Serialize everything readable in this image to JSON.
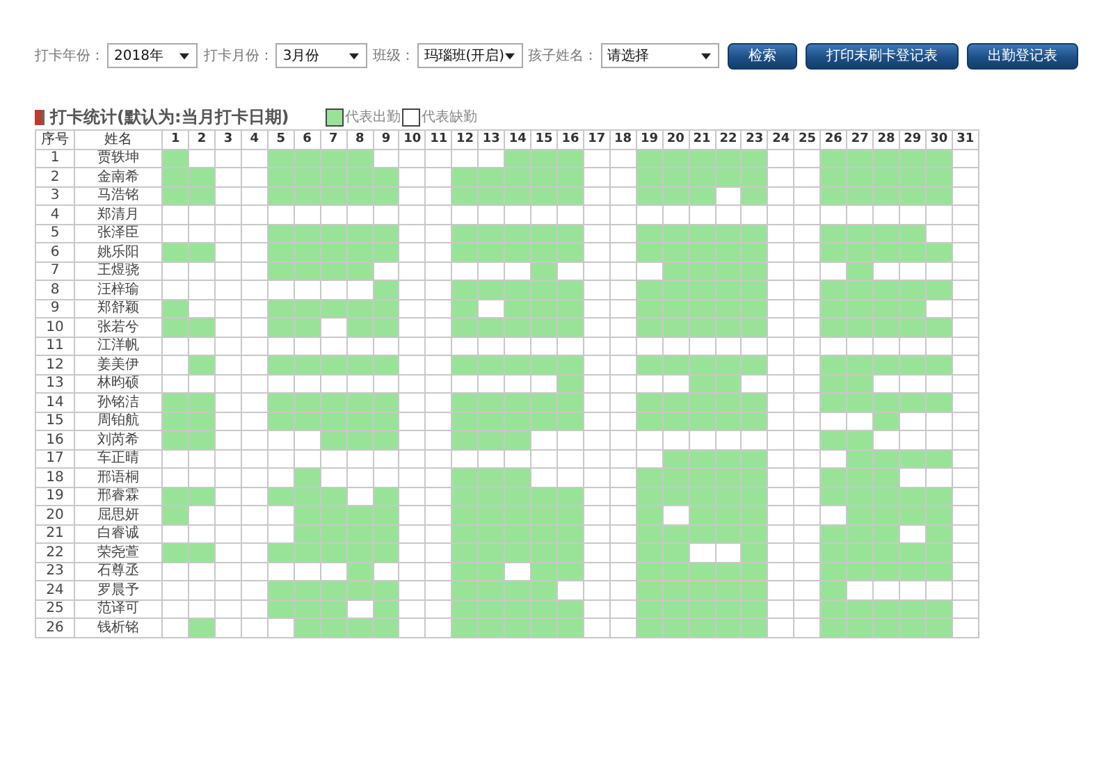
{
  "filters": [
    {
      "label": "打卡年份：",
      "value": "2018年",
      "kind": "year"
    },
    {
      "label": "打卡月份：",
      "value": "3月份",
      "kind": "month"
    },
    {
      "label": "班级：",
      "value": "玛瑙班(开启)",
      "kind": "class"
    },
    {
      "label": "孩子姓名：",
      "value": "请选择",
      "kind": "child"
    }
  ],
  "buttons": [
    "检索",
    "打印未刷卡登记表",
    "出勤登记表"
  ],
  "section_title": "打卡统计(默认为:当月打卡日期)",
  "legend": [
    {
      "label": "代表出勤",
      "present": true
    },
    {
      "label": "代表缺勤",
      "present": false
    }
  ],
  "table": {
    "columns": [
      "序号",
      "姓名"
    ],
    "days": [
      "1",
      "2",
      "3",
      "4",
      "5",
      "6",
      "7",
      "8",
      "9",
      "10",
      "11",
      "12",
      "13",
      "14",
      "15",
      "16",
      "17",
      "18",
      "19",
      "20",
      "21",
      "22",
      "23",
      "24",
      "25",
      "26",
      "27",
      "28",
      "29",
      "30",
      "31"
    ],
    "rows": [
      {
        "no": "1",
        "name": "贾轶坤",
        "attendance": [
          true,
          false,
          false,
          false,
          true,
          true,
          true,
          true,
          false,
          false,
          false,
          false,
          false,
          true,
          true,
          true,
          false,
          false,
          true,
          true,
          true,
          true,
          true,
          false,
          false,
          true,
          true,
          true,
          true,
          true,
          false
        ]
      },
      {
        "no": "2",
        "name": "金南希",
        "attendance": [
          true,
          true,
          false,
          false,
          true,
          true,
          true,
          true,
          true,
          false,
          false,
          true,
          true,
          true,
          true,
          true,
          false,
          false,
          true,
          true,
          true,
          true,
          true,
          false,
          false,
          true,
          true,
          true,
          true,
          true,
          false
        ]
      },
      {
        "no": "3",
        "name": "马浩铭",
        "attendance": [
          true,
          true,
          false,
          false,
          true,
          true,
          true,
          true,
          true,
          false,
          false,
          true,
          true,
          true,
          true,
          true,
          false,
          false,
          true,
          true,
          true,
          false,
          true,
          false,
          false,
          true,
          true,
          true,
          true,
          true,
          false
        ]
      },
      {
        "no": "4",
        "name": "郑清月",
        "attendance": [
          false,
          false,
          false,
          false,
          false,
          false,
          false,
          false,
          false,
          false,
          false,
          false,
          false,
          false,
          false,
          false,
          false,
          false,
          false,
          false,
          false,
          false,
          false,
          false,
          false,
          false,
          false,
          false,
          false,
          false,
          false
        ]
      },
      {
        "no": "5",
        "name": "张泽臣",
        "attendance": [
          false,
          false,
          false,
          false,
          true,
          true,
          true,
          true,
          true,
          false,
          false,
          true,
          true,
          true,
          true,
          true,
          false,
          false,
          true,
          true,
          true,
          true,
          true,
          false,
          false,
          true,
          true,
          true,
          true,
          false,
          false
        ]
      },
      {
        "no": "6",
        "name": "姚乐阳",
        "attendance": [
          true,
          true,
          false,
          false,
          true,
          true,
          true,
          true,
          true,
          false,
          false,
          true,
          true,
          true,
          true,
          true,
          false,
          false,
          true,
          true,
          true,
          true,
          true,
          false,
          false,
          true,
          true,
          true,
          true,
          true,
          false
        ]
      },
      {
        "no": "7",
        "name": "王煜骁",
        "attendance": [
          false,
          false,
          false,
          false,
          true,
          true,
          true,
          true,
          false,
          false,
          false,
          false,
          false,
          false,
          true,
          false,
          false,
          false,
          false,
          true,
          true,
          true,
          true,
          false,
          false,
          false,
          true,
          false,
          false,
          false,
          false
        ]
      },
      {
        "no": "8",
        "name": "汪梓瑜",
        "attendance": [
          false,
          false,
          false,
          false,
          false,
          false,
          false,
          false,
          true,
          false,
          false,
          true,
          true,
          true,
          true,
          true,
          false,
          false,
          true,
          true,
          true,
          true,
          true,
          false,
          false,
          true,
          true,
          true,
          true,
          true,
          false
        ]
      },
      {
        "no": "9",
        "name": "郑舒颖",
        "attendance": [
          true,
          false,
          false,
          false,
          true,
          true,
          true,
          true,
          true,
          false,
          false,
          true,
          false,
          true,
          true,
          true,
          false,
          false,
          true,
          true,
          true,
          true,
          true,
          false,
          false,
          true,
          true,
          true,
          true,
          false,
          false
        ]
      },
      {
        "no": "10",
        "name": "张若兮",
        "attendance": [
          true,
          true,
          false,
          false,
          true,
          true,
          false,
          true,
          true,
          false,
          false,
          true,
          true,
          true,
          true,
          true,
          false,
          false,
          true,
          true,
          true,
          true,
          true,
          false,
          false,
          true,
          true,
          true,
          true,
          true,
          false
        ]
      },
      {
        "no": "11",
        "name": "江洋帆",
        "attendance": [
          false,
          false,
          false,
          false,
          false,
          false,
          false,
          false,
          false,
          false,
          false,
          false,
          false,
          false,
          false,
          false,
          false,
          false,
          false,
          false,
          false,
          false,
          false,
          false,
          false,
          false,
          false,
          false,
          false,
          false,
          false
        ]
      },
      {
        "no": "12",
        "name": "姜美伊",
        "attendance": [
          false,
          true,
          false,
          false,
          true,
          true,
          true,
          true,
          true,
          false,
          false,
          true,
          true,
          true,
          true,
          true,
          false,
          false,
          true,
          true,
          true,
          true,
          true,
          false,
          false,
          true,
          true,
          true,
          true,
          true,
          false
        ]
      },
      {
        "no": "13",
        "name": "林昀硕",
        "attendance": [
          false,
          false,
          false,
          false,
          false,
          false,
          false,
          false,
          false,
          false,
          false,
          false,
          false,
          false,
          false,
          true,
          false,
          false,
          false,
          false,
          true,
          true,
          false,
          false,
          false,
          true,
          true,
          false,
          false,
          false,
          false
        ]
      },
      {
        "no": "14",
        "name": "孙铭洁",
        "attendance": [
          true,
          true,
          false,
          false,
          true,
          true,
          true,
          true,
          true,
          false,
          false,
          true,
          true,
          true,
          true,
          true,
          false,
          false,
          true,
          true,
          true,
          true,
          true,
          false,
          false,
          true,
          true,
          true,
          true,
          true,
          false
        ]
      },
      {
        "no": "15",
        "name": "周铂航",
        "attendance": [
          true,
          true,
          false,
          false,
          true,
          true,
          true,
          true,
          true,
          false,
          false,
          true,
          true,
          true,
          true,
          true,
          false,
          false,
          true,
          true,
          true,
          true,
          true,
          false,
          false,
          false,
          false,
          true,
          false,
          false,
          false
        ]
      },
      {
        "no": "16",
        "name": "刘芮希",
        "attendance": [
          true,
          true,
          false,
          false,
          false,
          false,
          true,
          true,
          true,
          false,
          false,
          true,
          true,
          true,
          false,
          false,
          false,
          false,
          false,
          false,
          false,
          false,
          false,
          false,
          false,
          true,
          true,
          false,
          false,
          false,
          false
        ]
      },
      {
        "no": "17",
        "name": "车正晴",
        "attendance": [
          false,
          false,
          false,
          false,
          false,
          false,
          false,
          false,
          false,
          false,
          false,
          false,
          false,
          false,
          false,
          false,
          false,
          false,
          false,
          true,
          true,
          true,
          true,
          false,
          false,
          false,
          true,
          true,
          true,
          true,
          false
        ]
      },
      {
        "no": "18",
        "name": "邢语桐",
        "attendance": [
          false,
          false,
          false,
          false,
          false,
          true,
          false,
          false,
          false,
          false,
          false,
          true,
          true,
          true,
          false,
          false,
          false,
          false,
          true,
          true,
          true,
          true,
          true,
          false,
          false,
          true,
          true,
          true,
          false,
          false,
          false
        ]
      },
      {
        "no": "19",
        "name": "邢睿霖",
        "attendance": [
          true,
          true,
          false,
          false,
          true,
          true,
          true,
          false,
          true,
          false,
          false,
          true,
          true,
          true,
          true,
          true,
          false,
          false,
          true,
          true,
          true,
          true,
          true,
          false,
          false,
          true,
          true,
          true,
          true,
          true,
          false
        ]
      },
      {
        "no": "20",
        "name": "屈思妍",
        "attendance": [
          true,
          false,
          false,
          false,
          false,
          true,
          true,
          true,
          true,
          false,
          false,
          true,
          true,
          true,
          true,
          true,
          false,
          false,
          true,
          false,
          true,
          true,
          true,
          false,
          false,
          false,
          true,
          true,
          true,
          true,
          false
        ]
      },
      {
        "no": "21",
        "name": "白睿诚",
        "attendance": [
          false,
          false,
          false,
          false,
          false,
          true,
          true,
          true,
          true,
          false,
          false,
          true,
          true,
          true,
          true,
          true,
          false,
          false,
          true,
          true,
          true,
          true,
          true,
          false,
          false,
          true,
          true,
          true,
          false,
          true,
          false
        ]
      },
      {
        "no": "22",
        "name": "荣尧萱",
        "attendance": [
          true,
          true,
          false,
          false,
          true,
          true,
          true,
          true,
          true,
          false,
          false,
          true,
          true,
          true,
          true,
          true,
          false,
          false,
          true,
          true,
          false,
          false,
          true,
          false,
          false,
          true,
          true,
          true,
          true,
          true,
          false
        ]
      },
      {
        "no": "23",
        "name": "石尊丞",
        "attendance": [
          false,
          false,
          false,
          false,
          false,
          false,
          false,
          true,
          false,
          false,
          false,
          true,
          true,
          false,
          true,
          true,
          false,
          false,
          true,
          true,
          true,
          true,
          true,
          false,
          false,
          true,
          true,
          true,
          true,
          true,
          false
        ]
      },
      {
        "no": "24",
        "name": "罗晨予",
        "attendance": [
          false,
          false,
          false,
          false,
          true,
          true,
          true,
          true,
          true,
          false,
          false,
          true,
          true,
          true,
          true,
          false,
          false,
          false,
          true,
          true,
          true,
          true,
          true,
          false,
          false,
          true,
          false,
          false,
          false,
          false,
          false
        ]
      },
      {
        "no": "25",
        "name": "范译可",
        "attendance": [
          false,
          false,
          false,
          false,
          true,
          true,
          true,
          false,
          true,
          false,
          false,
          true,
          true,
          true,
          true,
          true,
          false,
          false,
          true,
          true,
          true,
          true,
          true,
          false,
          false,
          true,
          true,
          true,
          true,
          true,
          false
        ]
      },
      {
        "no": "26",
        "name": "钱析铭",
        "attendance": [
          false,
          true,
          false,
          false,
          false,
          true,
          true,
          true,
          true,
          false,
          false,
          true,
          true,
          true,
          true,
          true,
          false,
          false,
          true,
          true,
          true,
          true,
          true,
          false,
          false,
          true,
          true,
          true,
          true,
          true,
          false
        ]
      }
    ]
  }
}
